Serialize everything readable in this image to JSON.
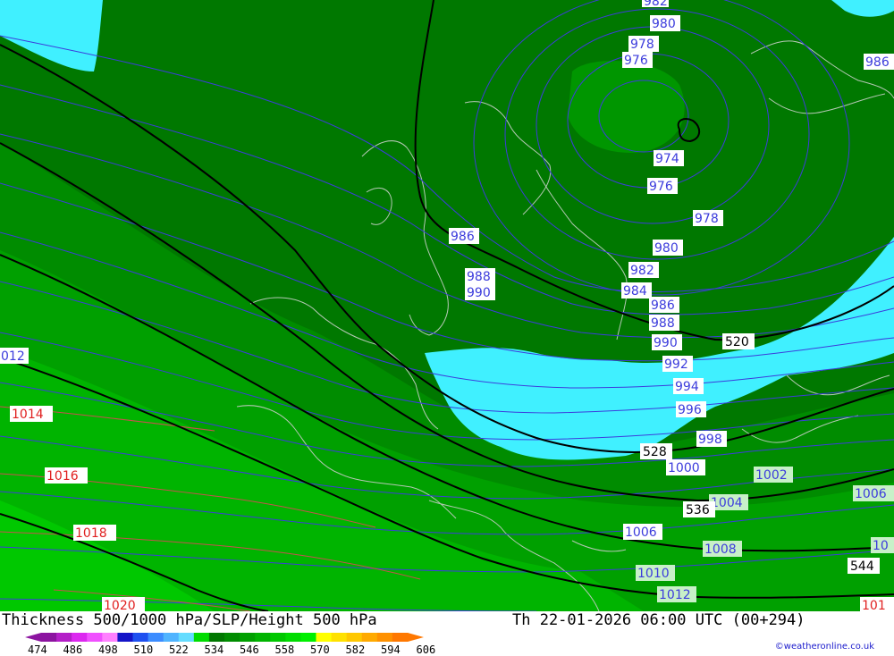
{
  "title": "Thickness 500/1000 hPa/SLP/Height 500 hPa",
  "valid_time": "Th 22-01-2026 06:00 UTC (00+294)",
  "credit": "©weatheronline.co.uk",
  "colors": {
    "pale_green": "#00c800",
    "light_green": "#00b400",
    "mid_green": "#00a000",
    "green": "#008c00",
    "dark_green": "#007800",
    "low_center": "#009600",
    "cold_cyan": "#40f0ff",
    "slp_blue": "#3c3cdc",
    "slp_red": "#c85050",
    "height_black": "#000000",
    "coast": "#b4c8b4"
  },
  "legend": {
    "ticks": [
      "474",
      "486",
      "498",
      "510",
      "522",
      "534",
      "546",
      "558",
      "570",
      "582",
      "594",
      "606"
    ],
    "colors": [
      "#8c14a0",
      "#b41ec8",
      "#dc28f0",
      "#f050ff",
      "#ff80ff",
      "#1414c8",
      "#1e50f0",
      "#3c8cff",
      "#50b4ff",
      "#64dcff",
      "#00dc00",
      "#007800",
      "#008c00",
      "#00a000",
      "#00b400",
      "#00c800",
      "#00dc00",
      "#00f000",
      "#ffff00",
      "#ffe100",
      "#ffc800",
      "#ffaa00",
      "#ff9100",
      "#ff7800"
    ]
  },
  "slp_labels": [
    {
      "text": "982"
    },
    {
      "text": "980"
    },
    {
      "text": "978"
    },
    {
      "text": "976"
    },
    {
      "text": "986"
    },
    {
      "text": "974"
    },
    {
      "text": "976"
    },
    {
      "text": "978"
    },
    {
      "text": "986"
    },
    {
      "text": "980"
    },
    {
      "text": "988"
    },
    {
      "text": "990"
    },
    {
      "text": "982"
    },
    {
      "text": "984"
    },
    {
      "text": "986"
    },
    {
      "text": "988"
    },
    {
      "text": "990"
    },
    {
      "text": "012"
    },
    {
      "text": "992"
    },
    {
      "text": "994"
    },
    {
      "text": "996"
    },
    {
      "text": "998"
    },
    {
      "text": "1000"
    },
    {
      "text": "1002"
    },
    {
      "text": "1004"
    },
    {
      "text": "1006"
    },
    {
      "text": "1006"
    },
    {
      "text": "1008"
    },
    {
      "text": "10"
    },
    {
      "text": "1010"
    },
    {
      "text": "1012"
    },
    {
      "text": "1014"
    },
    {
      "text": "1016"
    },
    {
      "text": "1018"
    },
    {
      "text": "1020"
    },
    {
      "text": "101"
    }
  ],
  "height_labels": [
    {
      "text": "520"
    },
    {
      "text": "528"
    },
    {
      "text": "536"
    },
    {
      "text": "544"
    }
  ]
}
